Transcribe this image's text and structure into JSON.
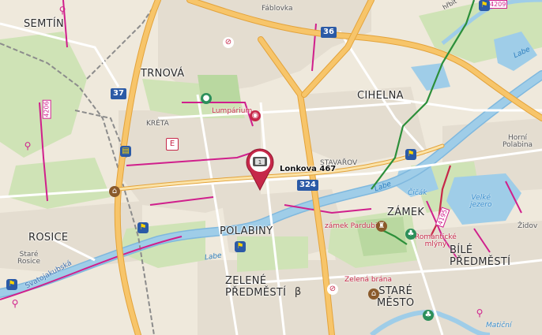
{
  "pin": {
    "label": "Lonkova 467",
    "icon": "parking-sign-icon"
  },
  "districts": {
    "semtin": "SEMTÍN",
    "trnova": "TRNOVÁ",
    "cihelna": "CIHELNA",
    "zamek": "ZÁMEK",
    "rosice": "ROSICE",
    "polabiny": "POLABINY",
    "bile_predmesti": [
      "BÍLÉ",
      "PŘEDMĚSTÍ"
    ],
    "zelene_predmesti": [
      "ZELENÉ",
      "PŘEDMĚSTÍ"
    ],
    "stare_mesto": [
      "STARÉ",
      "MĚSTO"
    ]
  },
  "small_places": {
    "fablovka": "Fáblovka",
    "kreta": "KRÉTA",
    "stavarov": "STAVAŘOV",
    "horni_polabina": [
      "Horní",
      "Polabina"
    ],
    "stare_rosice": [
      "Staré",
      "Rosice"
    ],
    "zidov": "Židov",
    "hrbitov": "hřbit"
  },
  "pois": {
    "lumparium": "Lumpárium",
    "zamek_pardubice": "zámek Pardubice",
    "zelena_brana": "Zelená brána",
    "romanticke_mlyny": [
      "Romantické",
      "mlýny"
    ]
  },
  "water": {
    "cicak": "Čičák",
    "velke_jezero": [
      "Velké",
      "jezero"
    ],
    "labe_1": "Labe",
    "labe_2": "Labe",
    "labe_3": "Labe",
    "maticni": "Matiční"
  },
  "trail": {
    "svatojakubska": "Svatojakubská"
  },
  "road_numbers": {
    "r36": "36",
    "r37": "37",
    "r324": "324"
  },
  "cycle_routes": {
    "c4209": "4209",
    "c4206": "4206",
    "c4195": "4195"
  },
  "colors": {
    "land": "#efe9dc",
    "residential": "#e4ddd0",
    "green": "#cfe3b6",
    "forest": "#b9d8a0",
    "water": "#9fcde8",
    "river": "#7fb8de",
    "road_major": "#f7c56a",
    "road_major_edge": "#e3a33b",
    "road_minor": "#ffffff",
    "cycle_route": "#d01f8c",
    "rail": "#8c8c8c",
    "pin": "#c62849",
    "hiking_green": "#2c8f3a",
    "hiking_red": "#c62849",
    "shield": "#2b5aa6"
  }
}
